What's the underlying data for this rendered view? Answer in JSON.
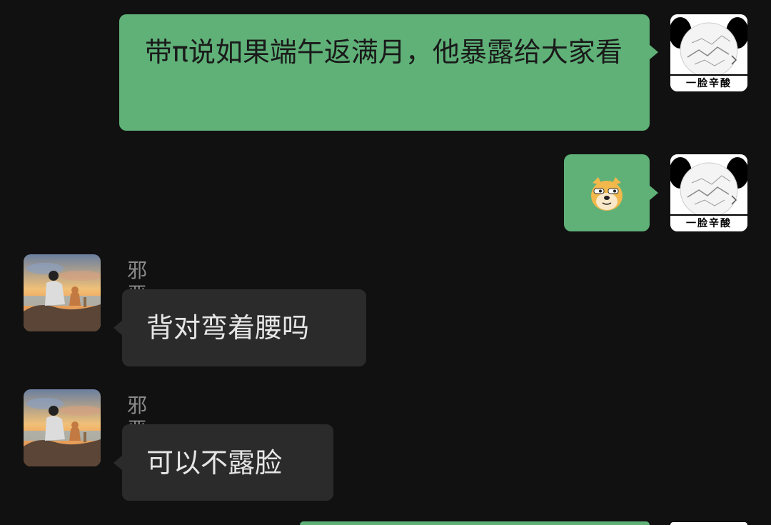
{
  "messages": [
    {
      "direction": "outgoing",
      "type": "text",
      "text": "带π说如果端午返满月，他暴露给大家看",
      "avatar": {
        "caption": "一脸辛酸",
        "icon": "panda-meme-avatar"
      }
    },
    {
      "direction": "outgoing",
      "type": "emoji",
      "emoji": "doge-emoji",
      "avatar": {
        "caption": "一脸辛酸",
        "icon": "panda-meme-avatar"
      }
    },
    {
      "direction": "incoming",
      "type": "text",
      "sender": "邪恶慢慢",
      "text": "背对弯着腰吗",
      "avatar": {
        "icon": "sunset-person-dog-avatar"
      }
    },
    {
      "direction": "incoming",
      "type": "text",
      "sender": "邪恶慢慢",
      "text": "可以不露脸",
      "avatar": {
        "icon": "sunset-person-dog-avatar"
      }
    }
  ],
  "colors": {
    "background": "#111111",
    "outgoing_bubble": "#5fb178",
    "incoming_bubble": "#2b2b2b",
    "sender_name": "#8a8a8a"
  }
}
